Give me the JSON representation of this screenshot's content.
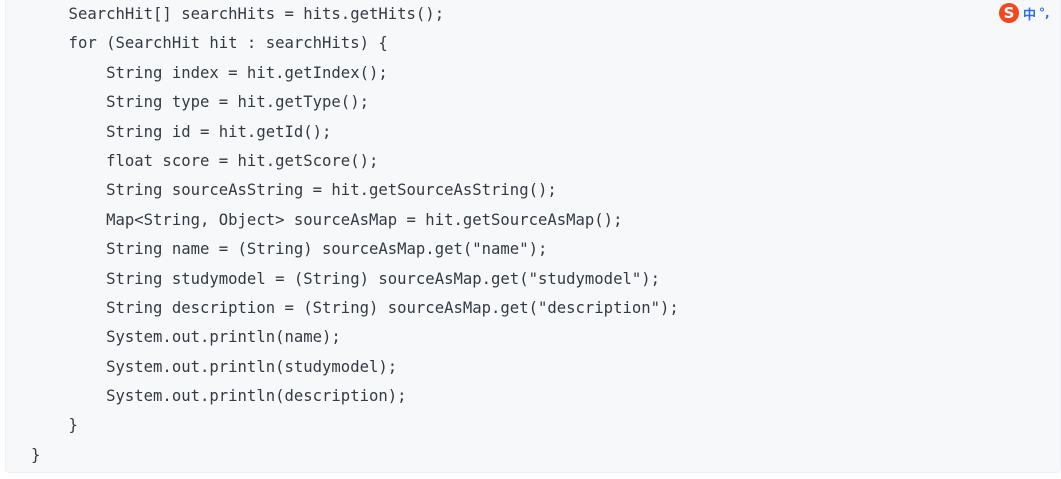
{
  "code": {
    "lines": [
      "    SearchHit[] searchHits = hits.getHits();",
      "    for (SearchHit hit : searchHits) {",
      "        String index = hit.getIndex();",
      "        String type = hit.getType();",
      "        String id = hit.getId();",
      "        float score = hit.getScore();",
      "        String sourceAsString = hit.getSourceAsString();",
      "        Map<String, Object> sourceAsMap = hit.getSourceAsMap();",
      "        String name = (String) sourceAsMap.get(\"name\");",
      "        String studymodel = (String) sourceAsMap.get(\"studymodel\");",
      "        String description = (String) sourceAsMap.get(\"description\");",
      "        System.out.println(name);",
      "        System.out.println(studymodel);",
      "        System.out.println(description);",
      "    }",
      "}"
    ]
  },
  "ime": {
    "logo_letter": "S",
    "mode_label": "中",
    "punct_label": "°,"
  }
}
